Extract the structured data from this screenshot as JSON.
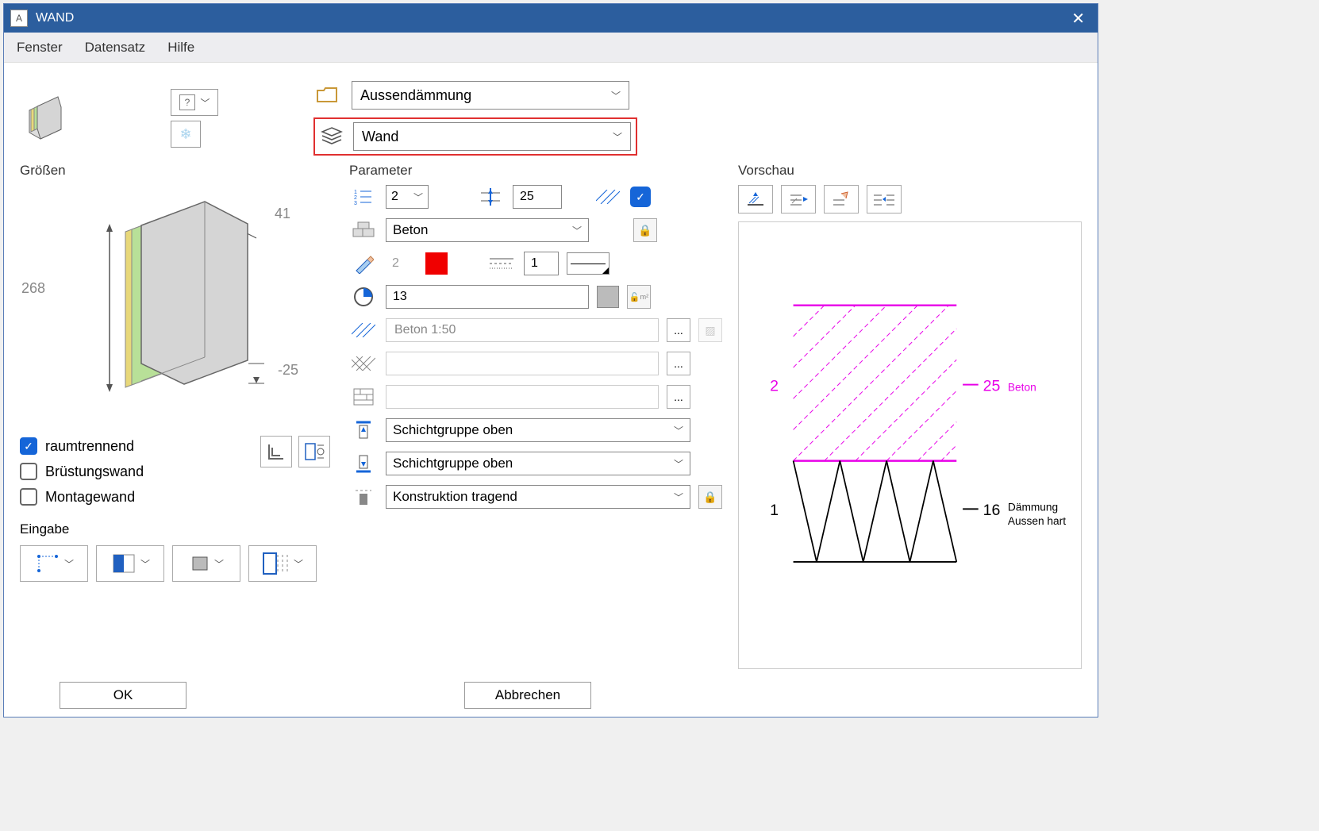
{
  "window": {
    "title": "WAND"
  },
  "menu": {
    "items": [
      "Fenster",
      "Datensatz",
      "Hilfe"
    ]
  },
  "selector": {
    "catalog": "Aussendämmung",
    "element": "Wand"
  },
  "sizes": {
    "title": "Größen",
    "height": "268",
    "top": "41",
    "bottom": "-25",
    "checks": {
      "room_separating": "raumtrennend",
      "parapet": "Brüstungswand",
      "mounting": "Montagewand"
    },
    "input_title": "Eingabe"
  },
  "parameter": {
    "title": "Parameter",
    "layer_count": "2",
    "thickness": "25",
    "material": "Beton",
    "pen_num": "2",
    "line_weight": "1",
    "fill_value": "13",
    "hatch_text": "Beton 1:50",
    "group_top": "Schichtgruppe oben",
    "group_bottom": "Schichtgruppe oben",
    "construction": "Konstruktion tragend"
  },
  "preview": {
    "title": "Vorschau",
    "layers": [
      {
        "num": "2",
        "thickness": "25",
        "material": "Beton",
        "color": "#e800e8"
      },
      {
        "num": "1",
        "thickness": "16",
        "material": "Dämmung\nAussen hart",
        "color": "#000"
      }
    ]
  },
  "buttons": {
    "ok": "OK",
    "cancel": "Abbrechen"
  },
  "colors": {
    "accent": "#1565d8",
    "highlight": "#e03030",
    "magenta": "#e800e8",
    "red": "#f00000"
  }
}
